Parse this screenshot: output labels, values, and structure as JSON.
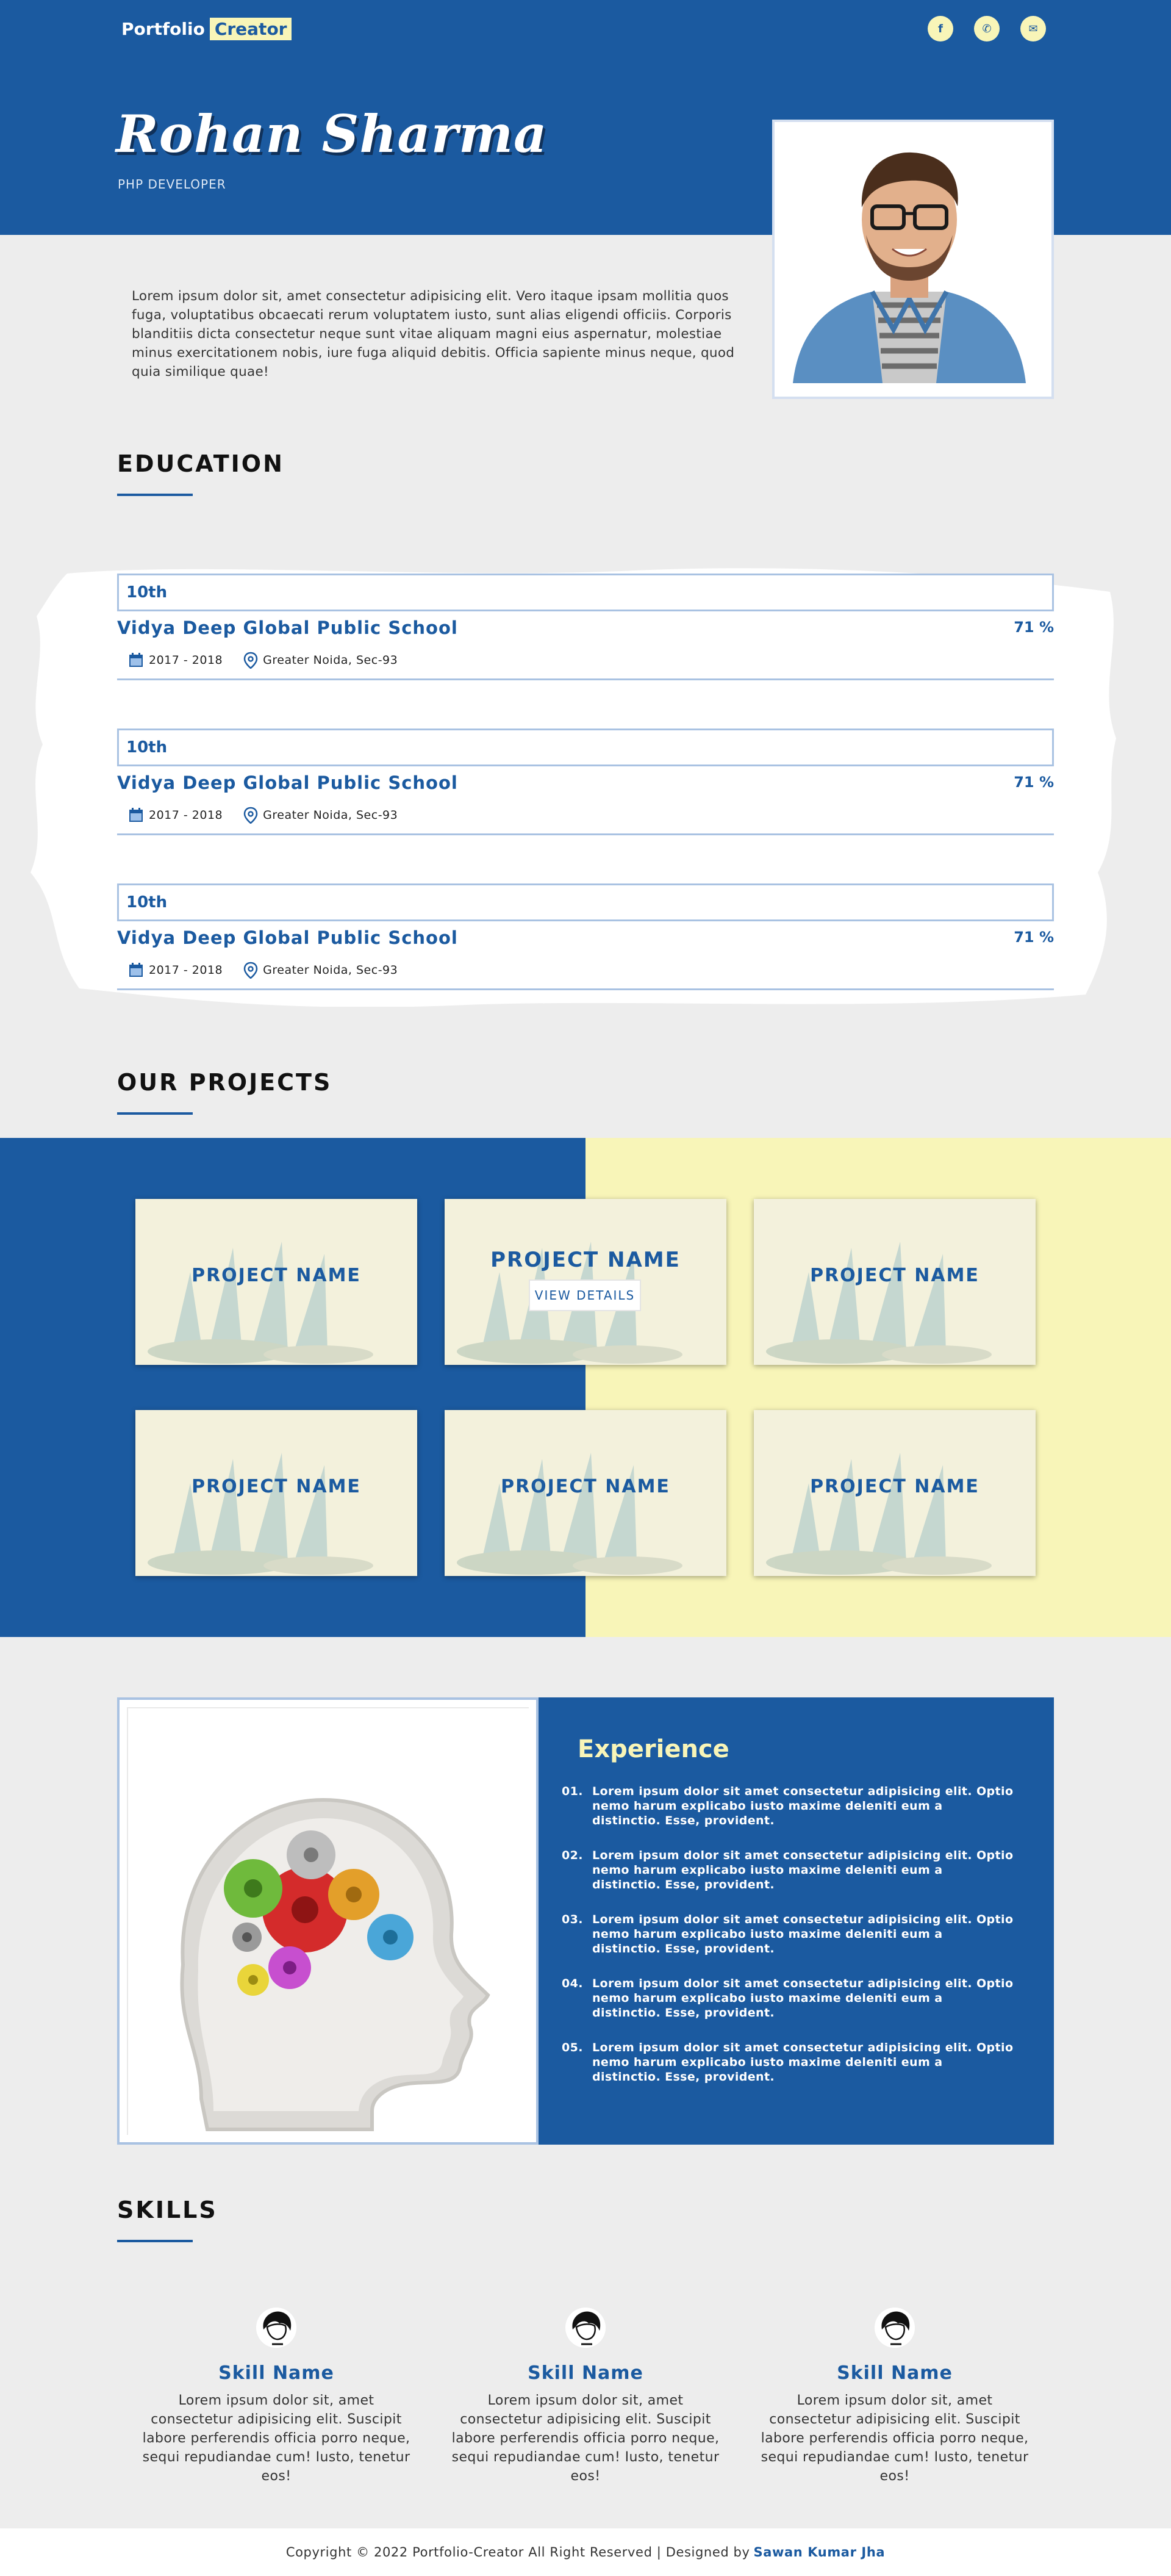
{
  "header": {
    "logo_part1": "Portfolio",
    "logo_part2": "Creator",
    "social": [
      {
        "icon": "facebook-icon",
        "glyph": "f"
      },
      {
        "icon": "phone-icon",
        "glyph": "✆"
      },
      {
        "icon": "mail-icon",
        "glyph": "✉"
      }
    ],
    "name": "Rohan Sharma",
    "role": "PHP DEVELOPER"
  },
  "about": {
    "text": "Lorem ipsum dolor sit, amet consectetur adipisicing elit. Vero itaque ipsam mollitia quos fuga, voluptatibus obcaecati rerum voluptatem iusto, sunt alias eligendi officiis. Corporis blanditiis dicta consectetur neque sunt vitae aliquam magni eius aspernatur, molestiae minus exercitationem nobis, iure fuga aliquid debitis. Officia sapiente minus neque, quod quia similique quae!"
  },
  "education": {
    "title": "EDUCATION",
    "items": [
      {
        "grade": "10th",
        "school": "Vidya Deep Global Public School",
        "percent": "71 %",
        "years": "2017 - 2018",
        "location": "Greater Noida, Sec-93"
      },
      {
        "grade": "10th",
        "school": "Vidya Deep Global Public School",
        "percent": "71 %",
        "years": "2017 - 2018",
        "location": "Greater Noida, Sec-93"
      },
      {
        "grade": "10th",
        "school": "Vidya Deep Global Public School",
        "percent": "71 %",
        "years": "2017 - 2018",
        "location": "Greater Noida, Sec-93"
      }
    ]
  },
  "projects": {
    "title": "OUR PROJECTS",
    "view_details": "VIEW DETAILS",
    "items": [
      {
        "name": "PROJECT NAME"
      },
      {
        "name": "PROJECT NAME"
      },
      {
        "name": "PROJECT NAME"
      },
      {
        "name": "PROJECT NAME"
      },
      {
        "name": "PROJECT NAME"
      },
      {
        "name": "PROJECT NAME"
      }
    ]
  },
  "experience": {
    "title": "Experience",
    "items": [
      {
        "num": "01.",
        "text": "Lorem ipsum dolor sit amet consectetur adipisicing elit. Optio nemo harum explicabo iusto maxime deleniti eum a distinctio. Esse, provident."
      },
      {
        "num": "02.",
        "text": "Lorem ipsum dolor sit amet consectetur adipisicing elit. Optio nemo harum explicabo iusto maxime deleniti eum a distinctio. Esse, provident."
      },
      {
        "num": "03.",
        "text": "Lorem ipsum dolor sit amet consectetur adipisicing elit. Optio nemo harum explicabo iusto maxime deleniti eum a distinctio. Esse, provident."
      },
      {
        "num": "04.",
        "text": "Lorem ipsum dolor sit amet consectetur adipisicing elit. Optio nemo harum explicabo iusto maxime deleniti eum a distinctio. Esse, provident."
      },
      {
        "num": "05.",
        "text": "Lorem ipsum dolor sit amet consectetur adipisicing elit. Optio nemo harum explicabo iusto maxime deleniti eum a distinctio. Esse, provident."
      }
    ]
  },
  "skills": {
    "title": "SKILLS",
    "items": [
      {
        "name": "Skill Name",
        "desc": "Lorem ipsum dolor sit, amet consectetur adipisicing elit. Suscipit labore perferendis officia porro neque, sequi repudiandae cum! Iusto, tenetur eos!"
      },
      {
        "name": "Skill Name",
        "desc": "Lorem ipsum dolor sit, amet consectetur adipisicing elit. Suscipit labore perferendis officia porro neque, sequi repudiandae cum! Iusto, tenetur eos!"
      },
      {
        "name": "Skill Name",
        "desc": "Lorem ipsum dolor sit, amet consectetur adipisicing elit. Suscipit labore perferendis officia porro neque, sequi repudiandae cum! Iusto, tenetur eos!"
      }
    ]
  },
  "footer": {
    "text": "Copyright © 2022 Portfolio-Creator All Right Reserved | Designed by",
    "designer": "Sawan Kumar Jha"
  },
  "colors": {
    "primary": "#1b5aa0",
    "accent": "#f8f5b8",
    "background": "#ededed"
  }
}
